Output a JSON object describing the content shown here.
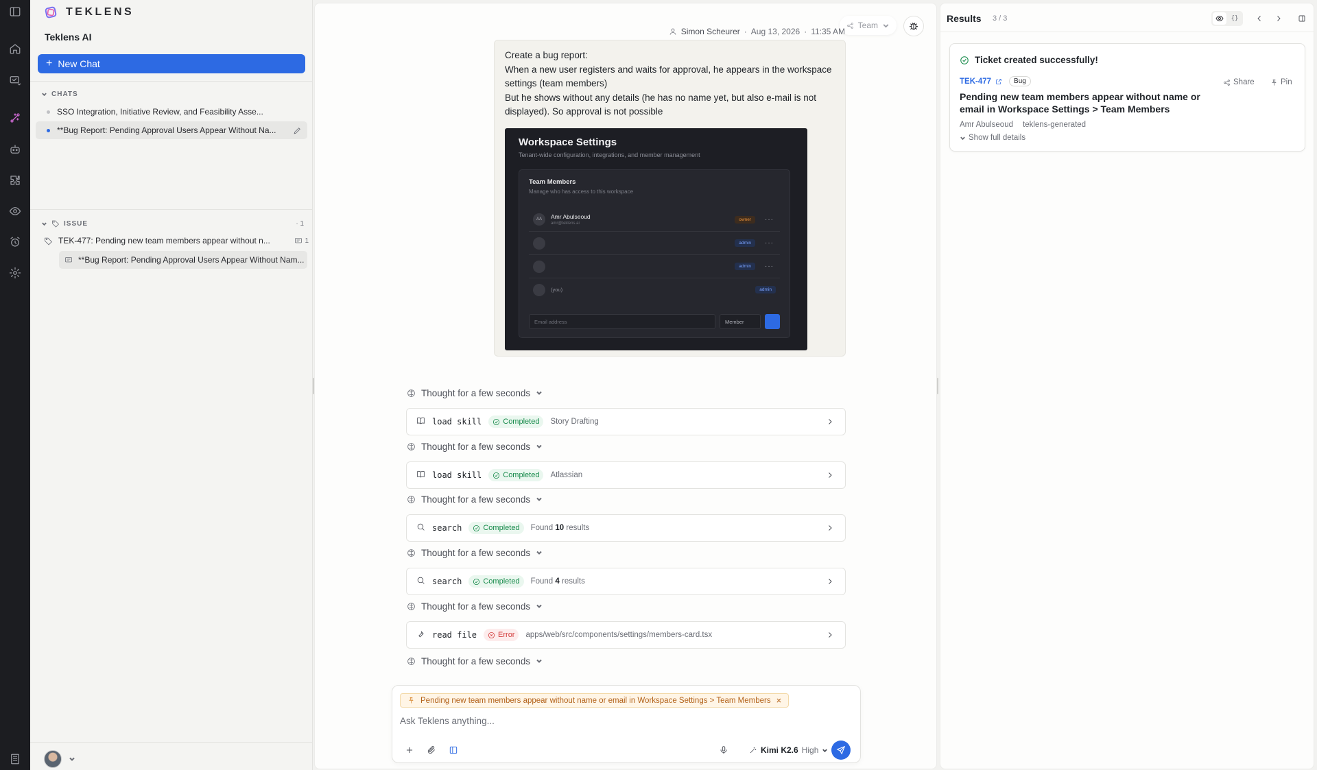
{
  "brand": {
    "name": "TEKLENS",
    "workspace": "Teklens AI",
    "new_chat": "New Chat"
  },
  "sidebar": {
    "chats_header": "CHATS",
    "chats": [
      {
        "title": "SSO Integration, Initiative Review, and Feasibility Asse..."
      },
      {
        "title": "**Bug Report: Pending Approval Users Appear Without Na..."
      }
    ],
    "issue_header": "ISSUE",
    "issue_count": "1",
    "issue_title": "TEK-477: Pending new team members appear without n...",
    "issue_chat_count": "1",
    "issue_chat": "**Bug Report: Pending Approval Users Appear Without Nam..."
  },
  "meta": {
    "author": "Simon Scheurer",
    "date": "Aug 13, 2026",
    "time": "11:35 AM",
    "visibility": "Team"
  },
  "message": {
    "lines": [
      "Create a bug report:",
      "When a new user registers and waits for approval, he appears in the workspace settings (team members)",
      "But he shows without any details (he has no name yet, but also e-mail is not displayed). So approval is not possible"
    ],
    "screenshot": {
      "title": "Workspace Settings",
      "subtitle": "Tenant-wide configuration, integrations, and member management",
      "card_title": "Team Members",
      "card_sub": "Manage who has access to this workspace",
      "rows": [
        {
          "initials": "AA",
          "name": "Amr Abulseoud",
          "email": "amr@teklens.ai",
          "role": "owner"
        },
        {
          "initials": "",
          "name": "",
          "email": "",
          "role": "admin"
        },
        {
          "initials": "",
          "name": "",
          "email": "",
          "role": "admin"
        },
        {
          "initials": "",
          "name": "(you)",
          "email": "",
          "role": "admin"
        }
      ],
      "email_placeholder": "Email address",
      "member_select": "Member"
    }
  },
  "thought_label": "Thought for a few seconds",
  "tools": [
    {
      "icon": "book-icon",
      "name": "load skill",
      "status": "Completed",
      "desc": "Story Drafting"
    },
    {
      "icon": "book-icon",
      "name": "load skill",
      "status": "Completed",
      "desc": "Atlassian"
    },
    {
      "icon": "search-icon",
      "name": "search",
      "status": "Completed",
      "desc_pre": "Found",
      "desc_num": "10",
      "desc_post": "results"
    },
    {
      "icon": "search-icon",
      "name": "search",
      "status": "Completed",
      "desc_pre": "Found",
      "desc_num": "4",
      "desc_post": "results"
    },
    {
      "icon": "wrench-icon",
      "name": "read file",
      "status": "Error",
      "desc": "apps/web/src/components/settings/members-card.tsx"
    }
  ],
  "composer": {
    "context_chip": "Pending new team members appear without name or email in Workspace Settings > Team Members",
    "placeholder": "Ask Teklens anything...",
    "model": "Kimi K2.6",
    "level": "High"
  },
  "results": {
    "title": "Results",
    "count": "3 / 3",
    "json_toggle": "{}",
    "card": {
      "status": "Ticket created successfully!",
      "key": "TEK-477",
      "badge": "Bug",
      "title": "Pending new team members appear without name or email in Workspace Settings > Team Members",
      "assignee": "Amr Abulseoud",
      "label": "teklens-generated",
      "show_more": "Show full details",
      "share": "Share",
      "pin": "Pin"
    }
  },
  "colors": {
    "accent": "#2d6ae3",
    "success": "#168a4a",
    "error": "#d33b3b",
    "rail": "#1c1d21"
  }
}
